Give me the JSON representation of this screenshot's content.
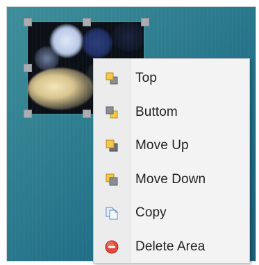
{
  "context_menu": {
    "items": [
      {
        "label": "Top",
        "icon": "bring-to-front-icon"
      },
      {
        "label": "Buttom",
        "icon": "send-to-back-icon"
      },
      {
        "label": "Move Up",
        "icon": "move-up-icon"
      },
      {
        "label": "Move Down",
        "icon": "move-down-icon"
      },
      {
        "label": "Copy",
        "icon": "copy-icon"
      },
      {
        "label": "Delete Area",
        "icon": "delete-icon"
      }
    ]
  },
  "colors": {
    "menu_background": "#f3f3f3",
    "canvas_background": "#2f7f90",
    "handle": "#a9adb2",
    "delete_icon": "#e14b3b"
  }
}
